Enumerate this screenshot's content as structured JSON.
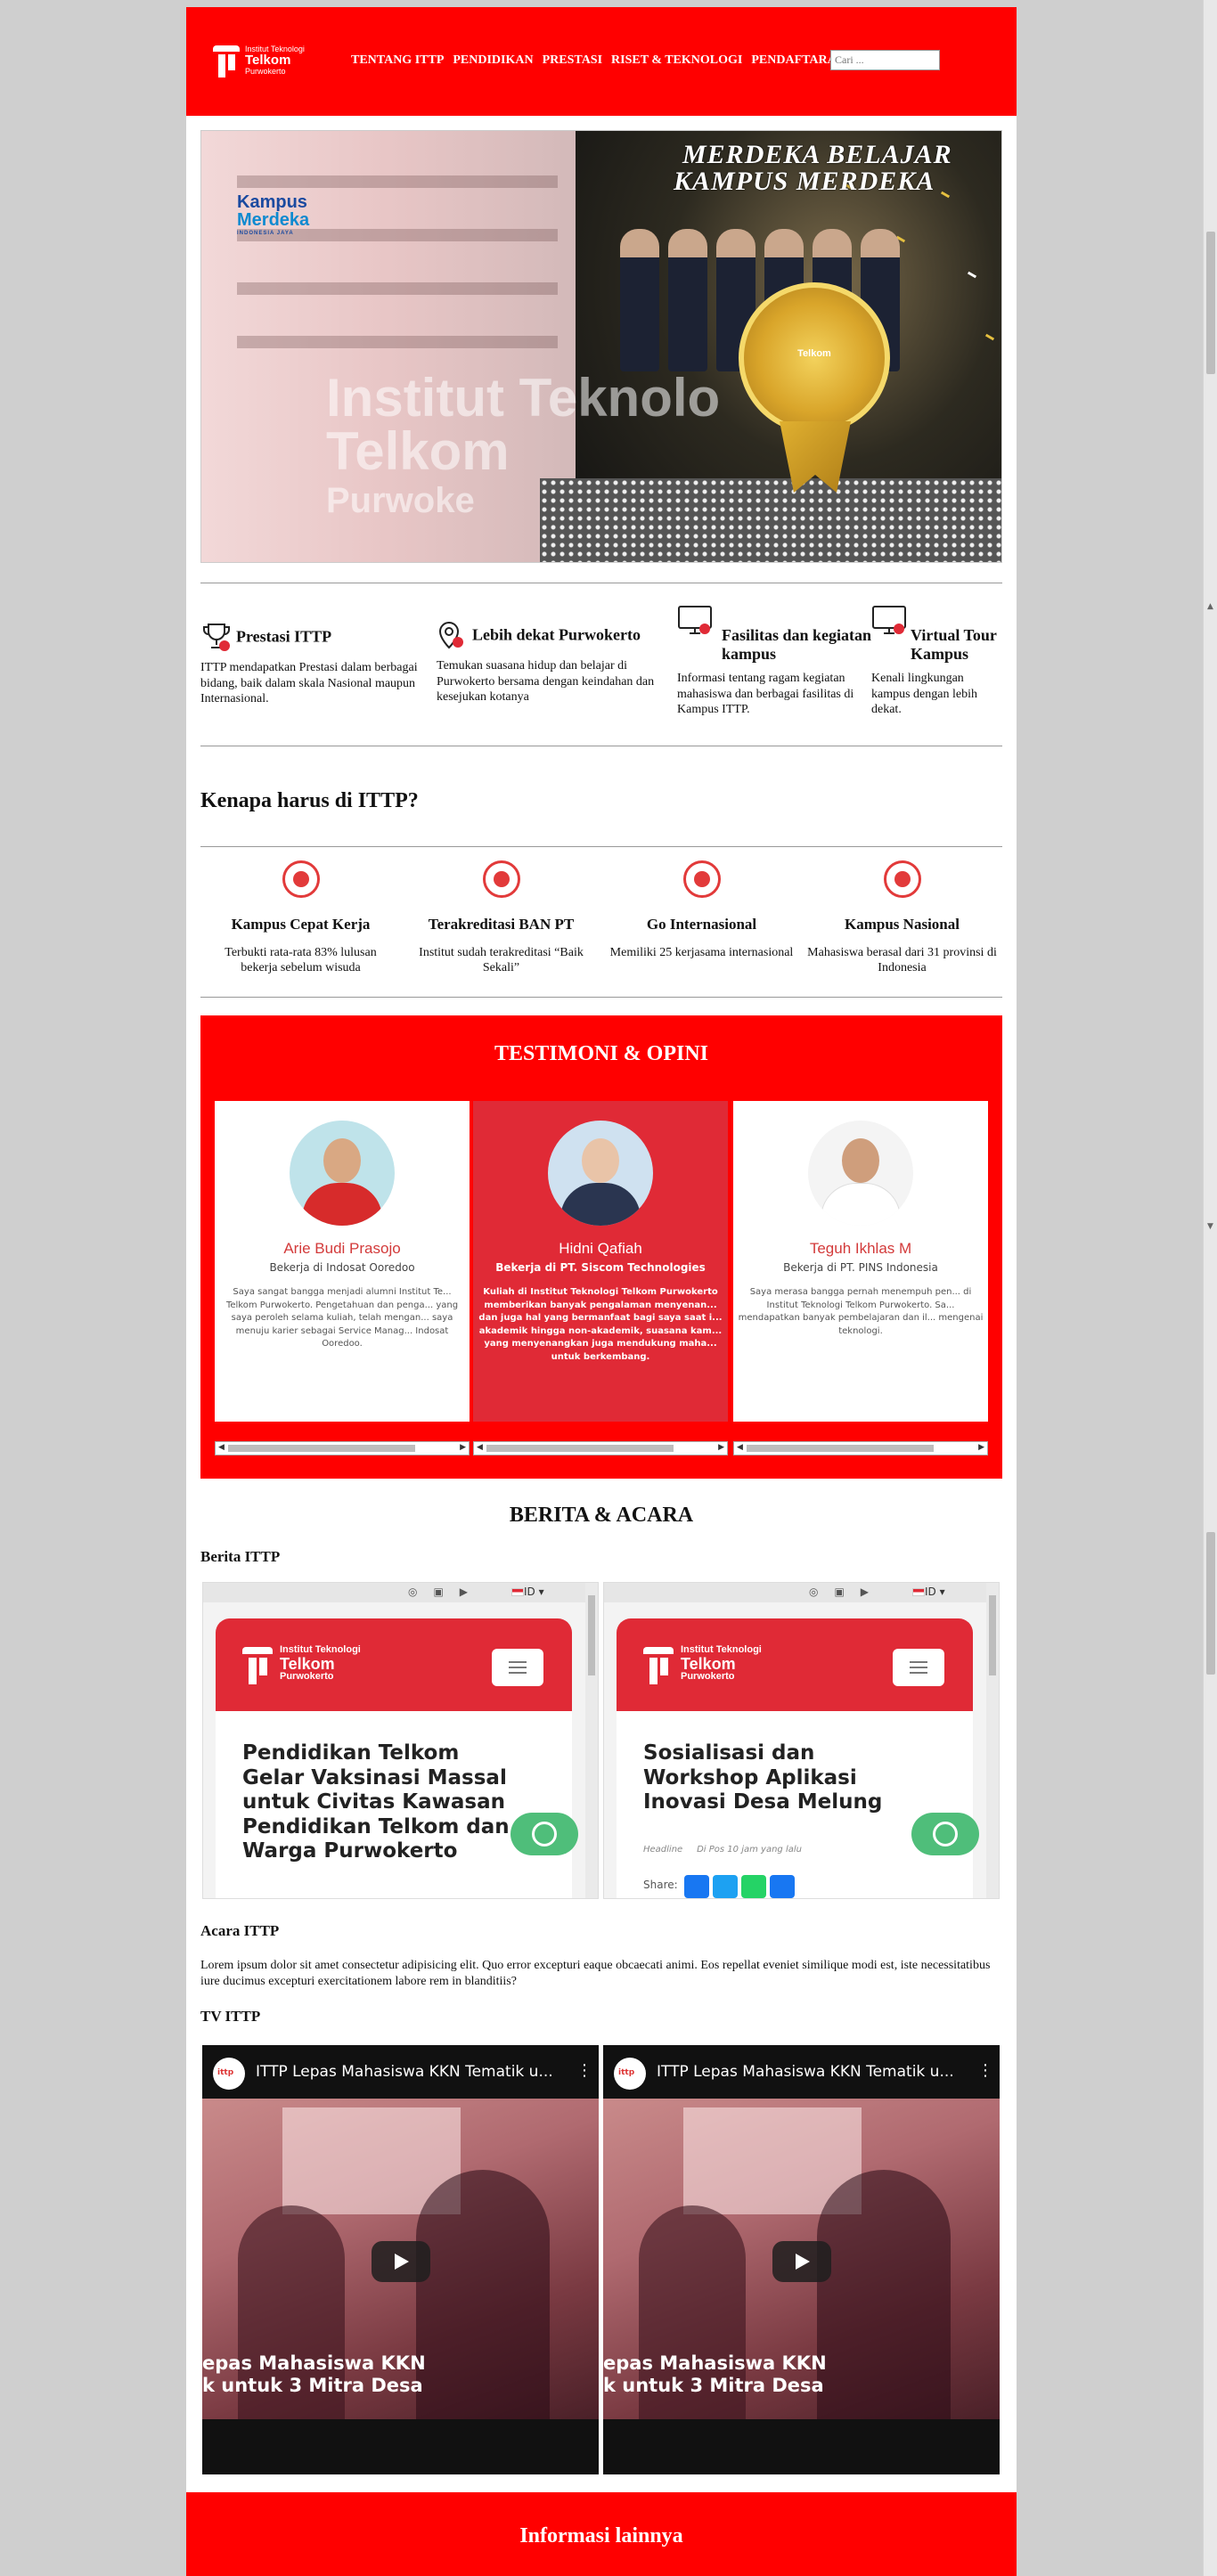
{
  "header": {
    "logo": {
      "line1": "Institut Teknologi",
      "line2": "Telkom",
      "line3": "Purwokerto"
    },
    "nav": [
      "TENTANG ITTP",
      "PENDIDIKAN",
      "PRESTASI",
      "RISET & TEKNOLOGI",
      "PENDAFTARAN"
    ],
    "search_placeholder": "Cari ..."
  },
  "hero": {
    "title_line1": "MERDEKA BELAJAR",
    "title_line2": "KAMPUS MERDEKA",
    "badge_line1": "Kampus",
    "badge_line2": "Merdeka",
    "badge_line3": "INDONESIA JAYA",
    "watermark_line1": "Institut Teknolo",
    "watermark_line2": "Telkom",
    "watermark_line3": "Purwoke",
    "medal_text": "Telkom",
    "colors": {
      "gold": "#d9a52a"
    }
  },
  "features": [
    {
      "icon": "trophy-icon",
      "title": "Prestasi ITTP",
      "desc": "ITTP mendapatkan Prestasi dalam berbagai bidang, baik dalam skala Nasional maupun Internasional."
    },
    {
      "icon": "map-pin-icon",
      "title": "Lebih dekat Purwokerto",
      "desc": "Temukan suasana hidup dan belajar di Purwokerto bersama dengan keindahan dan kesejukan kotanya"
    },
    {
      "icon": "monitor-icon",
      "title": "Fasilitas dan kegiatan kampus",
      "desc": "Informasi tentang ragam kegiatan mahasiswa dan berbagai fasilitas di Kampus ITTP."
    },
    {
      "icon": "monitor-icon",
      "title": "Virtual Tour Kampus",
      "desc": "Kenali lingkungan kampus dengan lebih dekat."
    }
  ],
  "why": {
    "title": "Kenapa harus di ITTP?",
    "items": [
      {
        "icon": "handshake-icon",
        "title": "Kampus Cepat Kerja",
        "desc": "Terbukti rata-rata 83% lulusan bekerja sebelum wisuda"
      },
      {
        "icon": "target-icon",
        "title": "Terakreditasi BAN PT",
        "desc": "Institut sudah terakreditasi “Baik Sekali”"
      },
      {
        "icon": "globe-icon",
        "title": "Go Internasional",
        "desc": "Memiliki 25 kerjasama internasional"
      },
      {
        "icon": "world-map-icon",
        "title": "Kampus Nasional",
        "desc": "Mahasiswa berasal dari 31 provinsi di Indonesia"
      }
    ]
  },
  "testimoni": {
    "title": "TESTIMONI & OPINI",
    "cards": [
      {
        "name": "Arie Budi Prasojo",
        "role": "Bekerja di Indosat Ooredoo",
        "quote": "Saya sangat bangga menjadi alumni Institut Te... Telkom Purwokerto. Pengetahuan dan penga... yang saya peroleh selama kuliah, telah mengan... saya menuju karier sebagai Service Manag... Indosat Ooredoo."
      },
      {
        "name": "Hidni Qafiah",
        "role": "Bekerja di PT. Siscom Technologies",
        "quote": "Kuliah di Institut Teknologi Telkom Purwokerto memberikan banyak pengalaman menyenan... dan juga hal yang bermanfaat bagi saya saat i... akademik hingga non-akademik, suasana kam... yang menyenangkan juga mendukung maha... untuk berkembang."
      },
      {
        "name": "Teguh Ikhlas M",
        "role": "Bekerja di PT. PINS Indonesia",
        "quote": "Saya merasa bangga pernah menempuh pen... di Institut Teknologi Telkom Purwokerto. Sa... mendapatkan banyak pembelajaran dan il... mengenai teknologi."
      }
    ]
  },
  "berita": {
    "title": "BERITA & ACARA",
    "news_label": "Berita ITTP",
    "news": [
      {
        "lang": "ID",
        "heading": "Pendidikan Telkom Gelar Vaksinasi Massal untuk Civitas Kawasan Pendidikan Telkom dan Warga Purwokerto",
        "meta": "",
        "share": ""
      },
      {
        "lang": "ID",
        "heading": "Sosialisasi dan Workshop Aplikasi Inovasi Desa Melung",
        "meta_tag": "Headline",
        "meta": "Di Pos 10 jam yang lalu",
        "share": "Share:"
      }
    ],
    "acara_label": "Acara ITTP",
    "acara_text": "Lorem ipsum dolor sit amet consectetur adipisicing elit. Quo error excepturi eaque obcaecati animi. Eos repellat eveniet similique modi est, iste necessitatibus iure ducimus excepturi exercitationem labore rem in blanditiis?",
    "tv_label": "TV ITTP",
    "videos": [
      {
        "channel": "ittp",
        "title": "ITTP Lepas Mahasiswa KKN Tematik u...",
        "caption1": "epas Mahasiswa KKN",
        "caption2": "k untuk 3 Mitra Desa"
      },
      {
        "channel": "ittp",
        "title": "ITTP Lepas Mahasiswa KKN Tematik u...",
        "caption1": "epas Mahasiswa KKN",
        "caption2": "k untuk 3 Mitra Desa"
      }
    ]
  },
  "footer": {
    "title": "Informasi lainnya"
  }
}
